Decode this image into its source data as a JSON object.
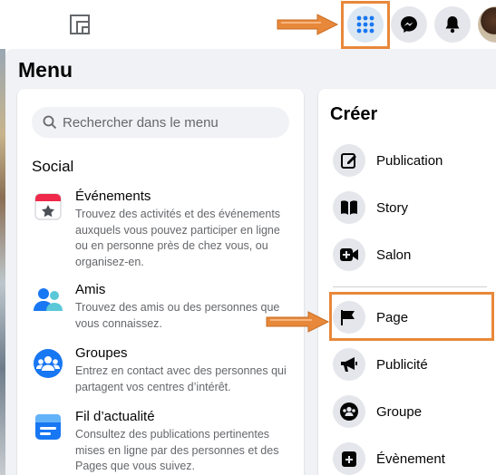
{
  "header": {
    "icons": [
      "logo-icon",
      "menu-grid-icon",
      "messenger-icon",
      "bell-icon",
      "avatar"
    ]
  },
  "menu": {
    "title": "Menu",
    "search": {
      "placeholder": "Rechercher dans le menu",
      "value": ""
    },
    "section": "Social",
    "items": [
      {
        "label": "Événements",
        "description": "Trouvez des activités et des événements auxquels vous pouvez participer en ligne ou en personne près de chez vous, ou organisez-en.",
        "icon": "calendar-icon"
      },
      {
        "label": "Amis",
        "description": "Trouvez des amis ou des personnes que vous connaissez.",
        "icon": "friends-icon"
      },
      {
        "label": "Groupes",
        "description": "Entrez en contact avec des personnes qui partagent vos centres d’intérêt.",
        "icon": "groups-icon"
      },
      {
        "label": "Fil d’actualité",
        "description": "Consultez des publications pertinentes mises en ligne par des personnes et des Pages que vous suivez.",
        "icon": "news-feed-icon"
      }
    ]
  },
  "create": {
    "title": "Créer",
    "items": [
      {
        "label": "Publication",
        "icon": "compose-icon"
      },
      {
        "label": "Story",
        "icon": "book-icon"
      },
      {
        "label": "Salon",
        "icon": "video-plus-icon"
      },
      {
        "label": "Page",
        "icon": "flag-icon"
      },
      {
        "label": "Publicité",
        "icon": "megaphone-icon"
      },
      {
        "label": "Groupe",
        "icon": "group-icon"
      },
      {
        "label": "Évènement",
        "icon": "event-plus-icon"
      }
    ]
  },
  "annotations": {
    "highlight_color": "#e8883a"
  },
  "colors": {
    "accent": "#1877f2",
    "panel": "#f0f2f5",
    "secondary_text": "#65676b"
  }
}
